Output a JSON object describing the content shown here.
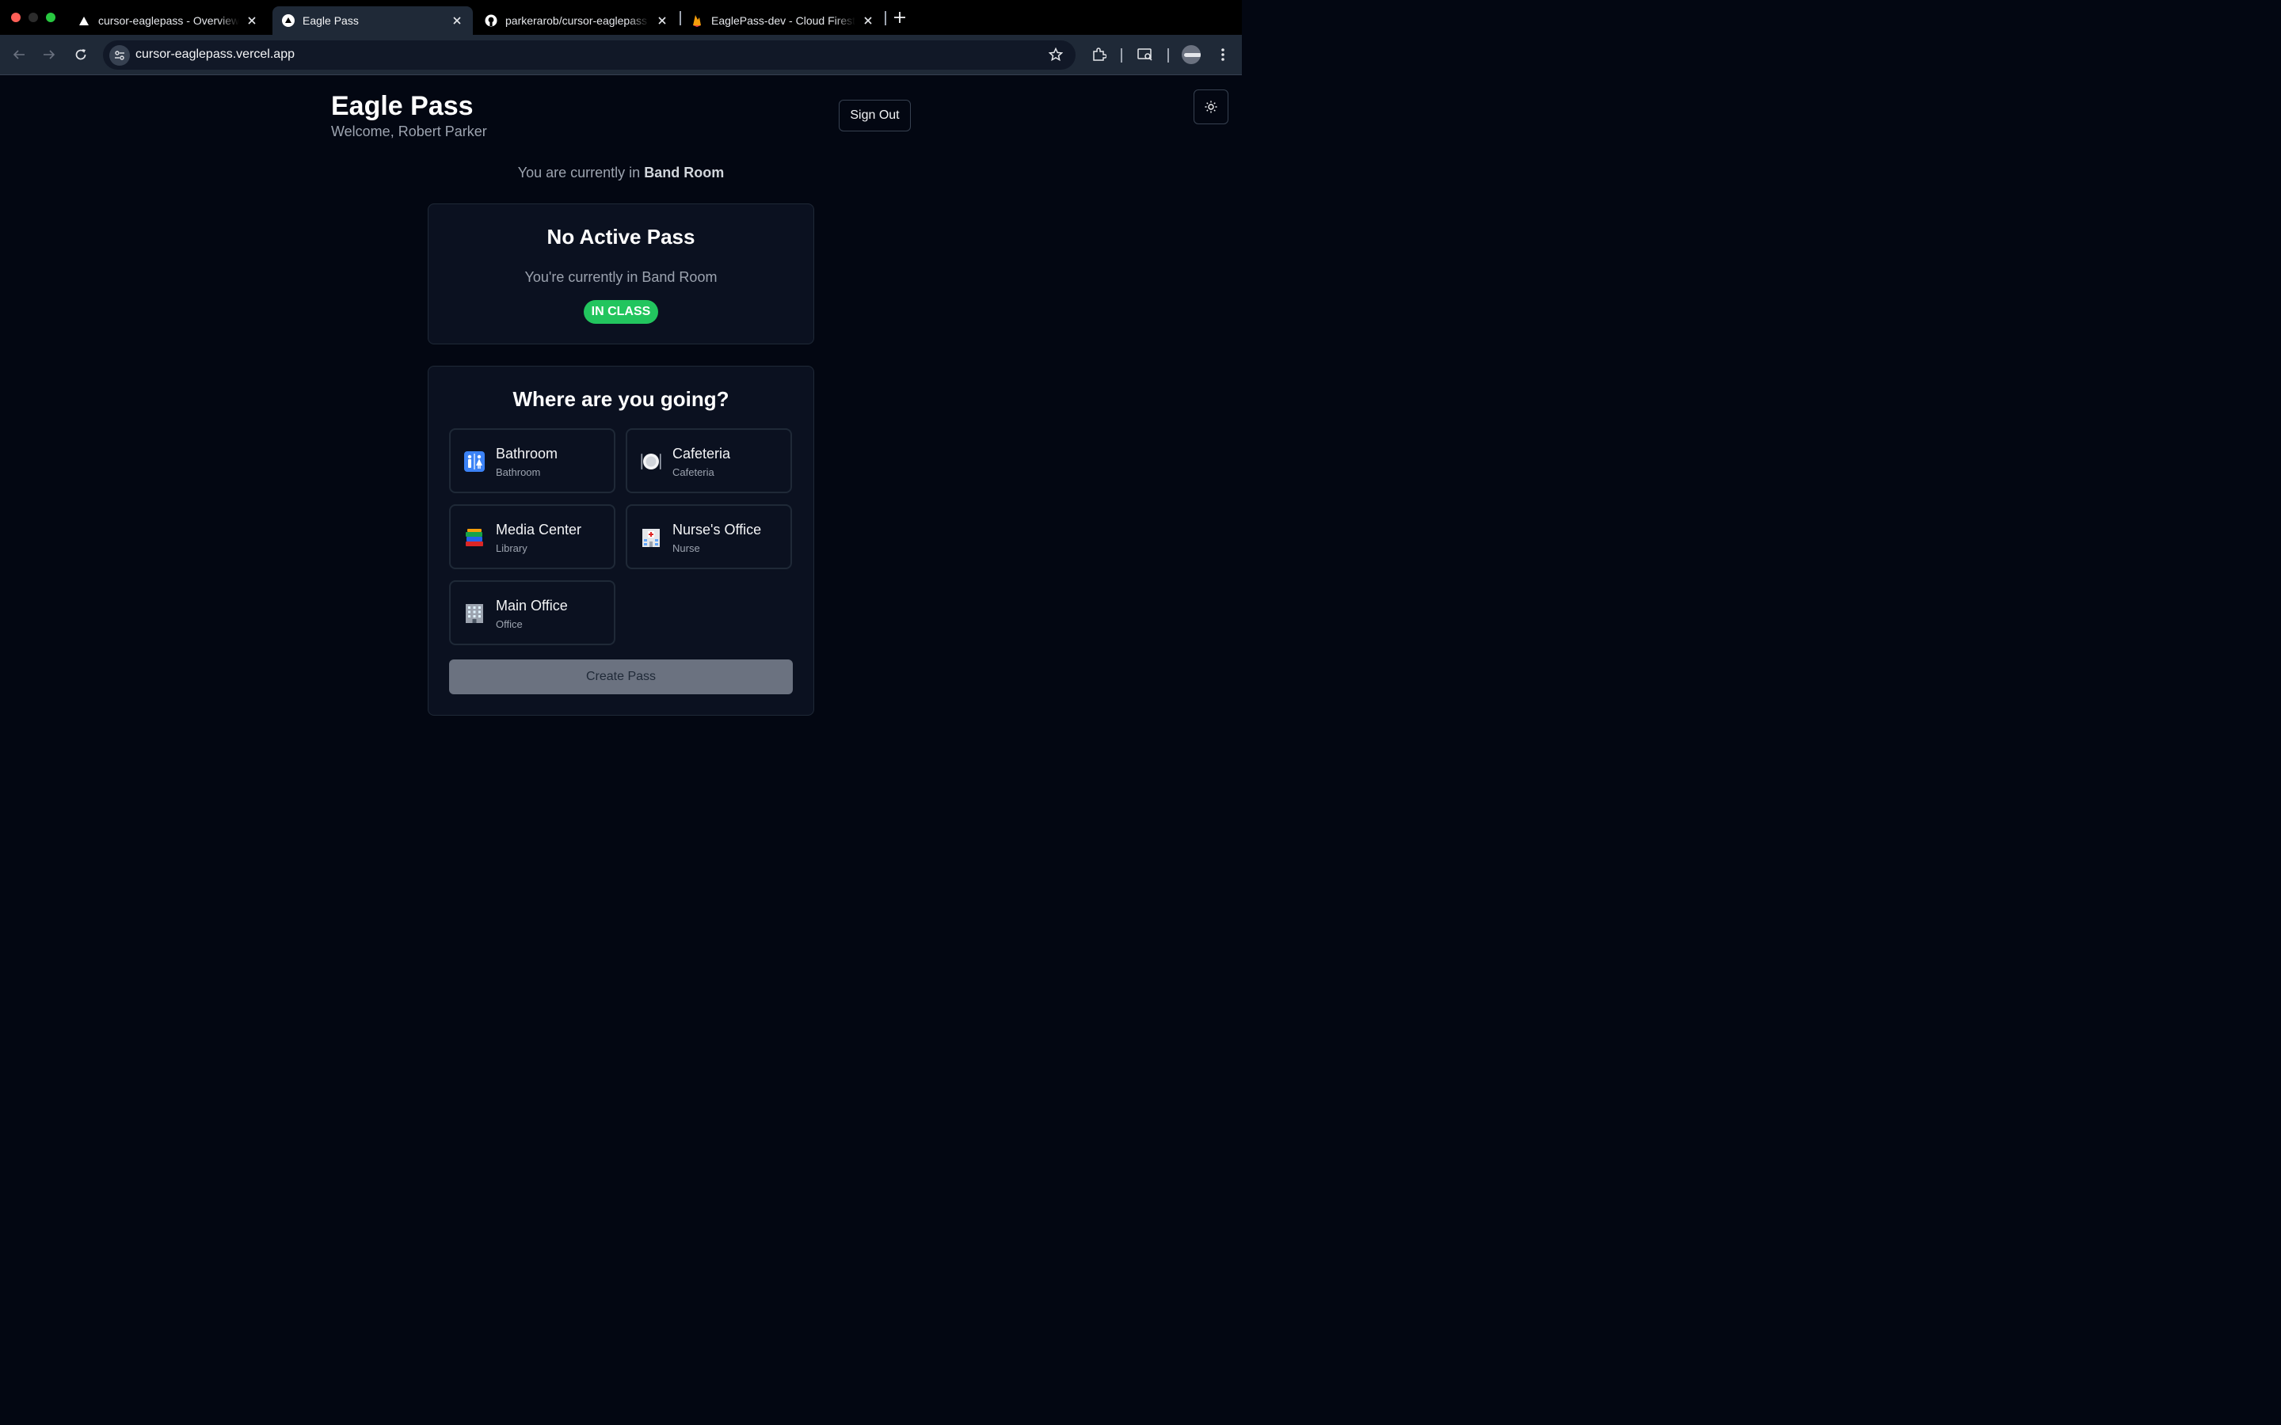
{
  "browser": {
    "tabs": [
      {
        "title": "cursor-eaglepass - Overview",
        "icon": "vercel-triangle-icon"
      },
      {
        "title": "Eagle Pass",
        "icon": "vercel-triangle-icon",
        "active": true
      },
      {
        "title": "parkerarob/cursor-eaglepass",
        "icon": "github-icon"
      },
      {
        "title": "EaglePass-dev - Cloud Firestore",
        "icon": "firebase-icon"
      }
    ],
    "url": "cursor-eaglepass.vercel.app"
  },
  "header": {
    "title": "Eagle Pass",
    "welcome": "Welcome, Robert Parker",
    "sign_out_label": "Sign Out",
    "theme_icon": "sun-icon"
  },
  "location": {
    "prefix": "You are currently in",
    "room": "Band Room"
  },
  "status_card": {
    "title": "No Active Pass",
    "subtitle": "You're currently in Band Room",
    "badge": "IN CLASS",
    "badge_color": "#22c55e"
  },
  "destinations": {
    "title": "Where are you going?",
    "items": [
      {
        "name": "Bathroom",
        "sub": "Bathroom",
        "icon": "restroom-icon"
      },
      {
        "name": "Cafeteria",
        "sub": "Cafeteria",
        "icon": "plate-cutlery-icon"
      },
      {
        "name": "Media Center",
        "sub": "Library",
        "icon": "books-icon"
      },
      {
        "name": "Nurse's Office",
        "sub": "Nurse",
        "icon": "hospital-icon"
      },
      {
        "name": "Main Office",
        "sub": "Office",
        "icon": "office-building-icon"
      }
    ],
    "create_label": "Create Pass"
  },
  "colors": {
    "page_bg": "#030712",
    "card_bg": "#0b1120",
    "border": "#1f2937",
    "create_button_disabled": "#6b7280"
  }
}
